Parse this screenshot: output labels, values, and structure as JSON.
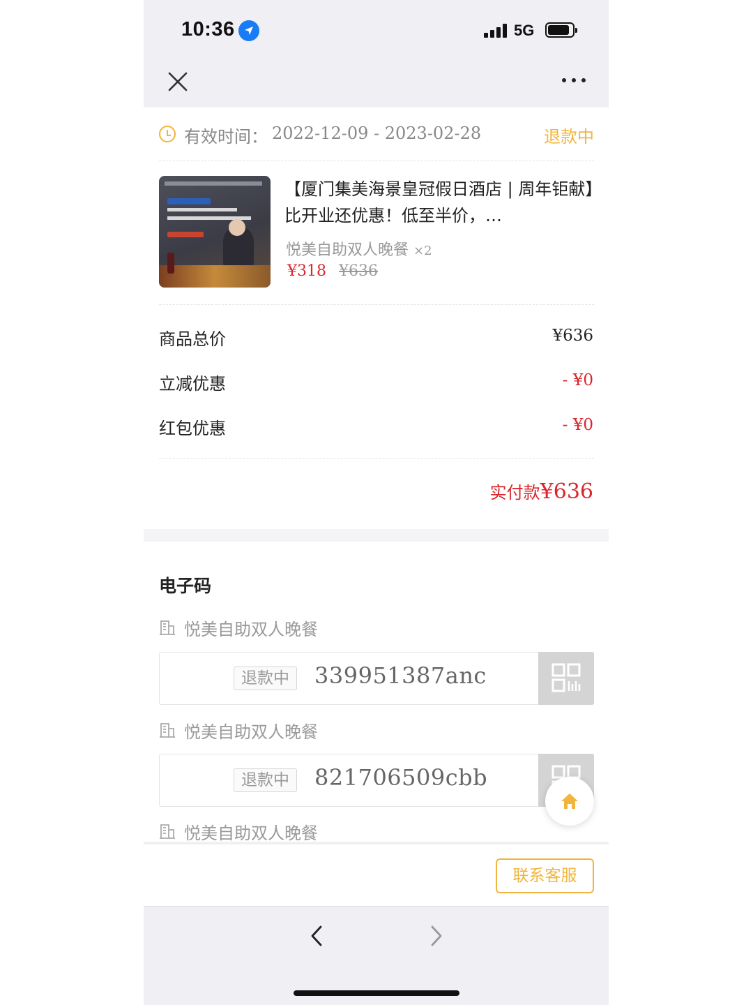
{
  "statusbar": {
    "time": "10:36",
    "network": "5G"
  },
  "order": {
    "validity_label": "有效时间：",
    "validity_range": "2022-12-09 - 2023-02-28",
    "status": "退款中"
  },
  "product": {
    "title": "【厦门集美海景皇冠假日酒店 | 周年钜献】比开业还优惠！低至半价，…",
    "variant": "悦美自助双人晚餐",
    "quantity": "×2",
    "price_now": "¥318",
    "price_old": "¥636"
  },
  "summary": {
    "rows": [
      {
        "label": "商品总价",
        "value": "¥636",
        "color": "#222222"
      },
      {
        "label": "立减优惠",
        "value": "- ¥0",
        "color": "#d9262c"
      },
      {
        "label": "红包优惠",
        "value": "- ¥0",
        "color": "#d9262c"
      }
    ],
    "total_label": "实付款",
    "total_amount": "¥636"
  },
  "ecodes": {
    "title": "电子码",
    "items": [
      {
        "name": "悦美自助双人晚餐",
        "badge": "退款中",
        "code": "339951387anc"
      },
      {
        "name": "悦美自助双人晚餐",
        "badge": "退款中",
        "code": "821706509cbb"
      },
      {
        "name": "悦美自助双人晚餐"
      }
    ]
  },
  "actions": {
    "contact": "联系客服"
  },
  "colors": {
    "accent": "#f0b53c",
    "price_red": "#d9262c",
    "icon_blue": "#1a7cf5"
  },
  "icons": [
    "location-arrow-icon",
    "signal-icon",
    "battery-icon",
    "close-icon",
    "more-icon",
    "clock-icon",
    "building-icon",
    "qr-code-icon",
    "home-icon",
    "back-icon",
    "forward-icon"
  ]
}
